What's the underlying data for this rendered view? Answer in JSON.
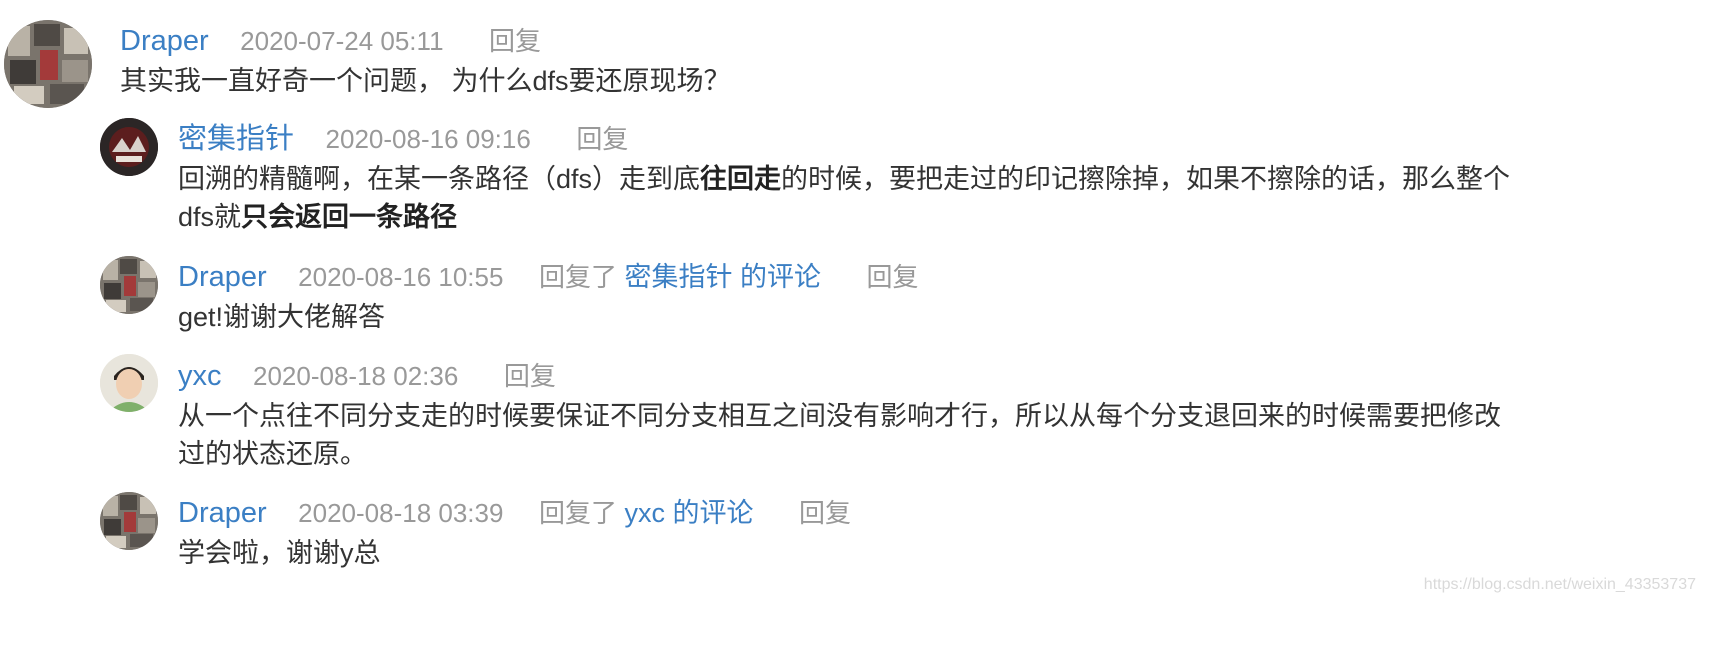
{
  "reply_label": "回复",
  "replied_label": "回复了",
  "comment_suffix": "的评论",
  "comments": [
    {
      "author": "Draper",
      "time": "2020-07-24 05:11",
      "avatar_icon": "collage-avatar-icon",
      "text": "其实我一直好奇一个问题， 为什么dfs要还原现场？"
    },
    {
      "author": "密集指针",
      "time": "2020-08-16 09:16",
      "avatar_icon": "dark-album-avatar-icon",
      "text_part1": "回溯的精髓啊，在某一条路径（dfs）走到底",
      "text_bold1": "往回走",
      "text_part2": "的时候，要把走过的印记擦除掉，如果不擦除的话，那么整个dfs就",
      "text_bold2": "只会返回一条路径"
    },
    {
      "author": "Draper",
      "time": "2020-08-16 10:55",
      "reply_to": "密集指针",
      "avatar_icon": "collage-avatar-icon",
      "text": "get!谢谢大佬解答"
    },
    {
      "author": "yxc",
      "time": "2020-08-18 02:36",
      "avatar_icon": "portrait-avatar-icon",
      "text": "从一个点往不同分支走的时候要保证不同分支相互之间没有影响才行，所以从每个分支退回来的时候需要把修改过的状态还原。"
    },
    {
      "author": "Draper",
      "time": "2020-08-18 03:39",
      "reply_to": "yxc",
      "avatar_icon": "collage-avatar-icon",
      "text": "学会啦，谢谢y总"
    }
  ],
  "watermark": "https://blog.csdn.net/weixin_43353737",
  "colors": {
    "link": "#3b7fc4",
    "muted": "#999999",
    "text": "#333333"
  }
}
